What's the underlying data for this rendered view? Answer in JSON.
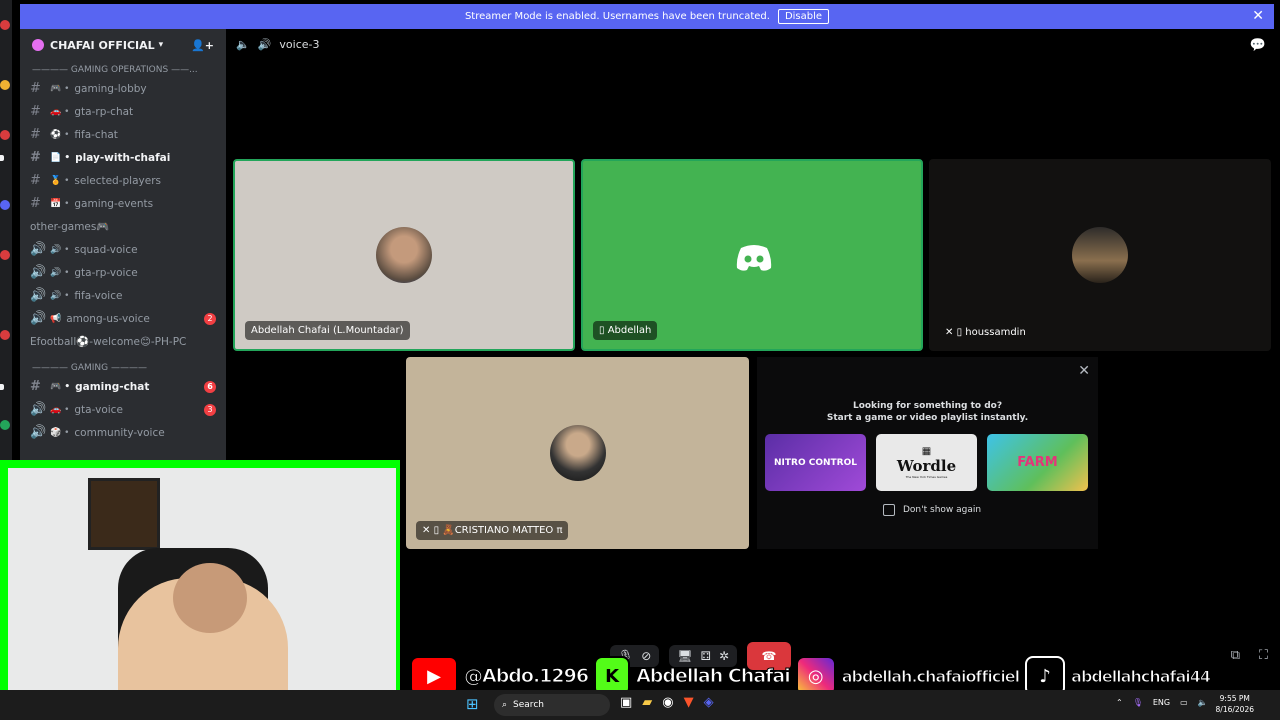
{
  "banner": {
    "text": "Streamer Mode is enabled. Usernames have been truncated.",
    "disable_label": "Disable"
  },
  "server": {
    "name": "CHAFAI OFFICIAL"
  },
  "sidebar": {
    "category1": "———— GAMING OPERATIONS ——...",
    "category2": "———— GAMING ————",
    "channels": [
      {
        "label": "gaming-lobby",
        "icon": "#",
        "emoji": "🎮 •"
      },
      {
        "label": "gta-rp-chat",
        "icon": "#",
        "emoji": "🚗 •"
      },
      {
        "label": "fifa-chat",
        "icon": "#",
        "emoji": "⚽ •"
      },
      {
        "label": "play-with-chafai",
        "icon": "#",
        "emoji": "📄 •"
      },
      {
        "label": "selected-players",
        "icon": "#",
        "emoji": "🏅 •"
      },
      {
        "label": "gaming-events",
        "icon": "#",
        "emoji": "📅 •"
      },
      {
        "label": "other-games🎮",
        "icon": "",
        "emoji": ""
      },
      {
        "label": "squad-voice",
        "icon": "🔊",
        "emoji": "🔊 •"
      },
      {
        "label": "gta-rp-voice",
        "icon": "🔊",
        "emoji": "🔊 •"
      },
      {
        "label": "fifa-voice",
        "icon": "🔊",
        "emoji": "🔊 •"
      },
      {
        "label": "among-us-voice",
        "icon": "🔊",
        "emoji": "📢",
        "badge": "2"
      },
      {
        "label": "Efootball⚽-welcome😊-PH-PC",
        "icon": "",
        "emoji": ""
      },
      {
        "label": "gaming-chat",
        "icon": "#",
        "emoji": "🎮 •",
        "badge": "6"
      },
      {
        "label": "gta-voice",
        "icon": "🔊",
        "emoji": "🚗 •",
        "badge": "3"
      },
      {
        "label": "community-voice",
        "icon": "🔊",
        "emoji": "🎲 •"
      }
    ]
  },
  "voice": {
    "channel_name": "voice-3"
  },
  "participants": [
    {
      "name": "Abdellah Chafai (L.Mountadar)"
    },
    {
      "name": "Abdellah"
    },
    {
      "name": "houssamdin"
    },
    {
      "name": "🧸CRISTIANO MATTEO π"
    }
  ],
  "activity_popup": {
    "line1": "Looking for something to do?",
    "line2": "Start a game or video playlist instantly.",
    "games": [
      "NITRO CONTROL",
      "Wordle",
      "FARM"
    ],
    "wordle_sub": "The New York Times Games",
    "dont_show": "Don't show again"
  },
  "socials": {
    "youtube": "@Abdo.1296",
    "kick": "Abdellah Chafai",
    "instagram": "abdellah.chafaiofficiel",
    "tiktok": "abdellahchafai44"
  },
  "taskbar": {
    "search_placeholder": "Search",
    "lang": "ENG",
    "time": "9:55 PM",
    "date": "8/16/2026"
  }
}
